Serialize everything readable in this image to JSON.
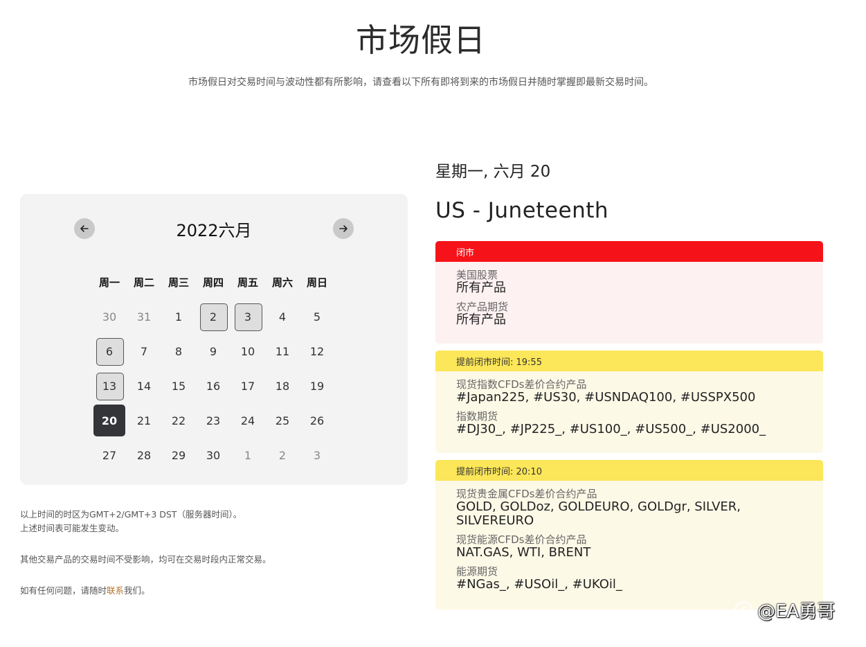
{
  "page": {
    "title": "市场假日",
    "subtitle": "市场假日对交易时间与波动性都有所影响，请查看以下所有即将到来的市场假日并随时掌握即最新交易时间。"
  },
  "calendar": {
    "month_label": "2022六月",
    "prev_icon": "arrow-left-icon",
    "next_icon": "arrow-right-icon",
    "weekdays": [
      "周一",
      "周二",
      "周三",
      "周四",
      "周五",
      "周六",
      "周日"
    ],
    "days": [
      {
        "d": "30",
        "muted": true
      },
      {
        "d": "31",
        "muted": true
      },
      {
        "d": "1"
      },
      {
        "d": "2",
        "holiday": true
      },
      {
        "d": "3",
        "holiday": true
      },
      {
        "d": "4"
      },
      {
        "d": "5"
      },
      {
        "d": "6",
        "holiday": true
      },
      {
        "d": "7"
      },
      {
        "d": "8"
      },
      {
        "d": "9"
      },
      {
        "d": "10"
      },
      {
        "d": "11"
      },
      {
        "d": "12"
      },
      {
        "d": "13",
        "holiday": true
      },
      {
        "d": "14"
      },
      {
        "d": "15"
      },
      {
        "d": "16"
      },
      {
        "d": "17"
      },
      {
        "d": "18"
      },
      {
        "d": "19"
      },
      {
        "d": "20",
        "selected": true
      },
      {
        "d": "21"
      },
      {
        "d": "22"
      },
      {
        "d": "23"
      },
      {
        "d": "24"
      },
      {
        "d": "25"
      },
      {
        "d": "26"
      },
      {
        "d": "27"
      },
      {
        "d": "28"
      },
      {
        "d": "29"
      },
      {
        "d": "30"
      },
      {
        "d": "1",
        "muted": true
      },
      {
        "d": "2",
        "muted": true
      },
      {
        "d": "3",
        "muted": true
      }
    ]
  },
  "notes": {
    "line1": "以上时间的时区为GMT+2/GMT+3 DST（服务器时间）。",
    "line2": "上述时间表可能发生变动。",
    "line3": "其他交易产品的交易时间不受影响，均可在交易时段内正常交易。",
    "line4_pre": "如有任何问题，请随时",
    "line4_link": "联系",
    "line4_post": "我们。"
  },
  "detail": {
    "day": "星期一, 六月 20",
    "event": "US - Juneteenth",
    "blocks": [
      {
        "header": "闭市",
        "groups": [
          {
            "label": "美国股票",
            "value": "所有产品"
          },
          {
            "label": "农产品期货",
            "value": "所有产品"
          }
        ]
      },
      {
        "header": "提前闭市时间: 19:55",
        "groups": [
          {
            "label": "现货指数CFDs差价合约产品",
            "value": "#Japan225, #US30, #USNDAQ100, #USSPX500"
          },
          {
            "label": "指数期货",
            "value": "#DJ30_, #JP225_, #US100_, #US500_, #US2000_"
          }
        ]
      },
      {
        "header": "提前闭市时间: 20:10",
        "groups": [
          {
            "label": "现货贵金属CFDs差价合约产品",
            "value": "GOLD, GOLDoz, GOLDEURO, GOLDgr, SILVER, SILVEREURO"
          },
          {
            "label": "现货能源CFDs差价合约产品",
            "value": "NAT.GAS, WTI, BRENT"
          },
          {
            "label": "能源期货",
            "value": "#NGas_, #USOil_, #UKOil_"
          }
        ]
      }
    ]
  },
  "watermark": {
    "text": "@EA勇哥"
  },
  "colors": {
    "closed": "#f51319",
    "early": "#fce659",
    "selected_day": "#333538"
  }
}
